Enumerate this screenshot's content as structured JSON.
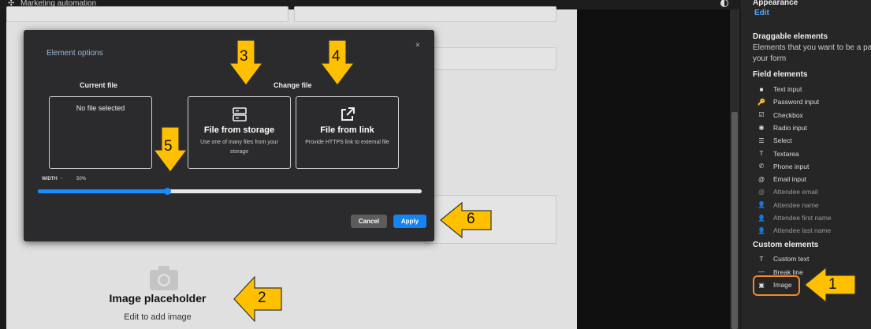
{
  "topbar": {
    "title": "Marketing automation",
    "logo_icon": "share-nodes-icon",
    "theme_icon": "contrast-icon"
  },
  "canvas": {
    "image_placeholder_title": "Image placeholder",
    "image_placeholder_subtitle": "Edit to add image"
  },
  "modal": {
    "title": "Element options",
    "close": "×",
    "current_file_heading": "Current file",
    "current_file_value": "No file selected",
    "change_file_heading": "Change file",
    "storage": {
      "title": "File from storage",
      "desc": "Use one of many files from your storage"
    },
    "link": {
      "title": "File from link",
      "desc": "Provide HTTPS link to external file"
    },
    "width_label": "WIDTH",
    "width_value": "50%",
    "width_fraction": 0.337,
    "cancel_label": "Cancel",
    "apply_label": "Apply",
    "accent": "#1584f0"
  },
  "sidebar": {
    "appearance_heading": "Appearance",
    "edit_link": "Edit",
    "draggable_heading": "Draggable elements",
    "draggable_desc_1": "Elements that you want to be a part o",
    "draggable_desc_2": "your form",
    "field_heading": "Field elements",
    "field_items": [
      {
        "label": "Text input",
        "icon": "■"
      },
      {
        "label": "Password input",
        "icon": "🔑"
      },
      {
        "label": "Checkbox",
        "icon": "☑"
      },
      {
        "label": "Radio input",
        "icon": "◉"
      },
      {
        "label": "Select",
        "icon": "☰"
      },
      {
        "label": "Textarea",
        "icon": "T"
      },
      {
        "label": "Phone input",
        "icon": "✆"
      },
      {
        "label": "Email input",
        "icon": "@"
      },
      {
        "label": "Attendee email",
        "icon": "@"
      },
      {
        "label": "Attendee name",
        "icon": "👤"
      },
      {
        "label": "Attendee first name",
        "icon": "👤"
      },
      {
        "label": "Attendee last name",
        "icon": "👤"
      }
    ],
    "custom_heading": "Custom elements",
    "custom_items": [
      {
        "label": "Custom text",
        "icon": "T"
      },
      {
        "label": "Break line",
        "icon": "—"
      },
      {
        "label": "Image",
        "icon": "▣"
      }
    ],
    "highlight_color": "#f08a2b"
  },
  "annotations": {
    "n1": "1",
    "n2": "2",
    "n3": "3",
    "n4": "4",
    "n5": "5",
    "n6": "6",
    "color": "#ffc000"
  }
}
